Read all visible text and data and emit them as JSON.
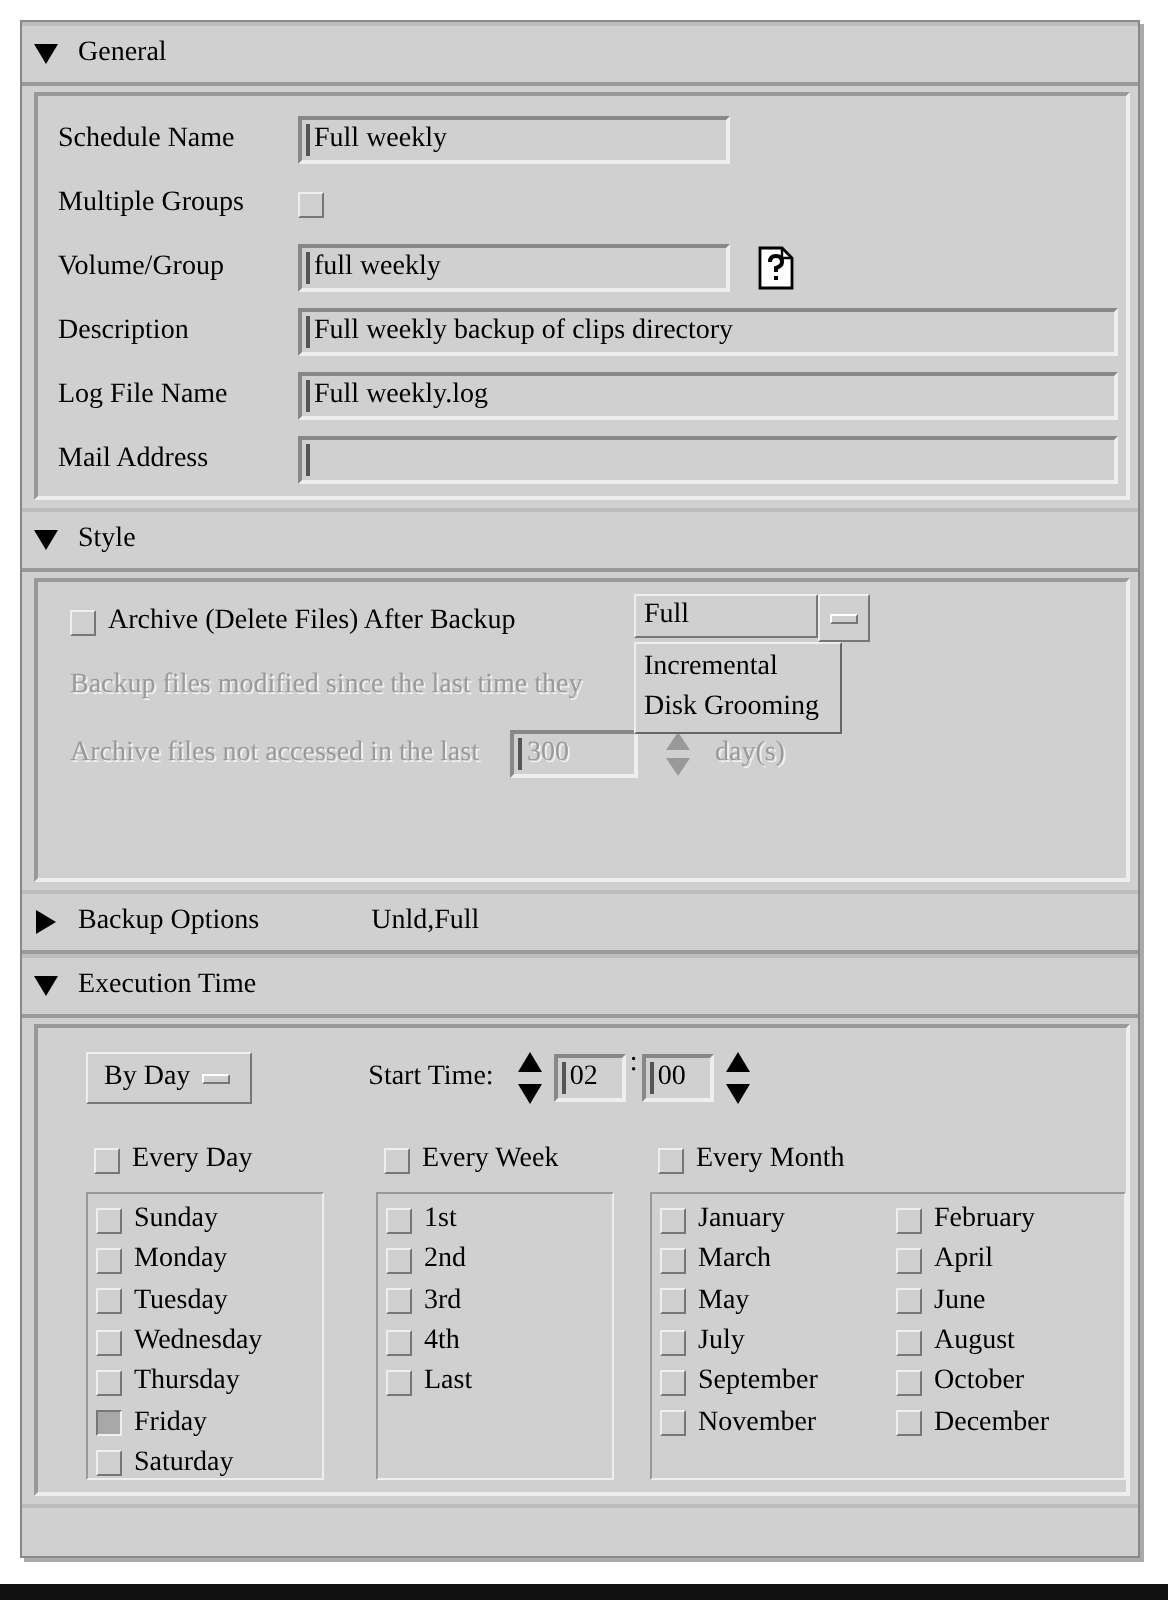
{
  "sections": [
    {
      "kind": "general",
      "title": "General",
      "expanded": true,
      "fields": [
        {
          "kind": "text",
          "label": "Schedule Name",
          "value": "Full  weekly",
          "wide": false
        },
        {
          "kind": "checkbox",
          "label": "Multiple Groups",
          "checked": false
        },
        {
          "kind": "browse",
          "label": "Volume/Group",
          "value": "full  weekly",
          "wide": false
        },
        {
          "kind": "text",
          "label": "Description",
          "value": "Full weekly backup of clips directory",
          "wide": true
        },
        {
          "kind": "text",
          "label": "Log File Name",
          "value": "Full  weekly.log",
          "wide": true
        },
        {
          "kind": "text",
          "label": "Mail Address",
          "wide": true
        }
      ]
    },
    {
      "kind": "style",
      "title": "Style",
      "expanded": true,
      "archive": {
        "label": "Archive (Delete Files) After Backup",
        "checked": false
      },
      "backup_type": {
        "value": "Full",
        "options": [
          "Incremental",
          "Disk Grooming"
        ]
      },
      "modified_note": {
        "text": "Backup files modified since the last time they",
        "disabled": true
      },
      "archive_age": {
        "label": "Archive files not accessed in the last",
        "value": "300",
        "unit": "day(s)",
        "disabled": true
      }
    },
    {
      "kind": "summary",
      "title": "Backup Options",
      "expanded": false,
      "summary": "Unld,Full"
    },
    {
      "kind": "execution",
      "title": "Execution Time",
      "expanded": true,
      "mode": "By Day",
      "start_label": "Start Time:",
      "hour": "02",
      "separator": ":",
      "minute": "00",
      "groups": [
        {
          "label": "Every Day",
          "checked": false,
          "items": [
            {
              "label": "Sunday",
              "checked": false
            },
            {
              "label": "Monday",
              "checked": false
            },
            {
              "label": "Tuesday",
              "checked": false
            },
            {
              "label": "Wednesday",
              "checked": false
            },
            {
              "label": "Thursday",
              "checked": false
            },
            {
              "label": "Friday",
              "checked": true
            },
            {
              "label": "Saturday",
              "checked": false
            }
          ]
        },
        {
          "label": "Every Week",
          "checked": false,
          "items": [
            {
              "label": "1st",
              "checked": false
            },
            {
              "label": "2nd",
              "checked": false
            },
            {
              "label": "3rd",
              "checked": false
            },
            {
              "label": "4th",
              "checked": false
            },
            {
              "label": "Last",
              "checked": false
            }
          ]
        },
        {
          "label": "Every Month",
          "checked": false,
          "items": [
            {
              "label": "January",
              "checked": false
            },
            {
              "label": "February",
              "checked": false
            },
            {
              "label": "March",
              "checked": false
            },
            {
              "label": "April",
              "checked": false
            },
            {
              "label": "May",
              "checked": false
            },
            {
              "label": "June",
              "checked": false
            },
            {
              "label": "July",
              "checked": false
            },
            {
              "label": "August",
              "checked": false
            },
            {
              "label": "September",
              "checked": false
            },
            {
              "label": "October",
              "checked": false
            },
            {
              "label": "November",
              "checked": false
            },
            {
              "label": "December",
              "checked": false
            }
          ]
        }
      ]
    }
  ]
}
